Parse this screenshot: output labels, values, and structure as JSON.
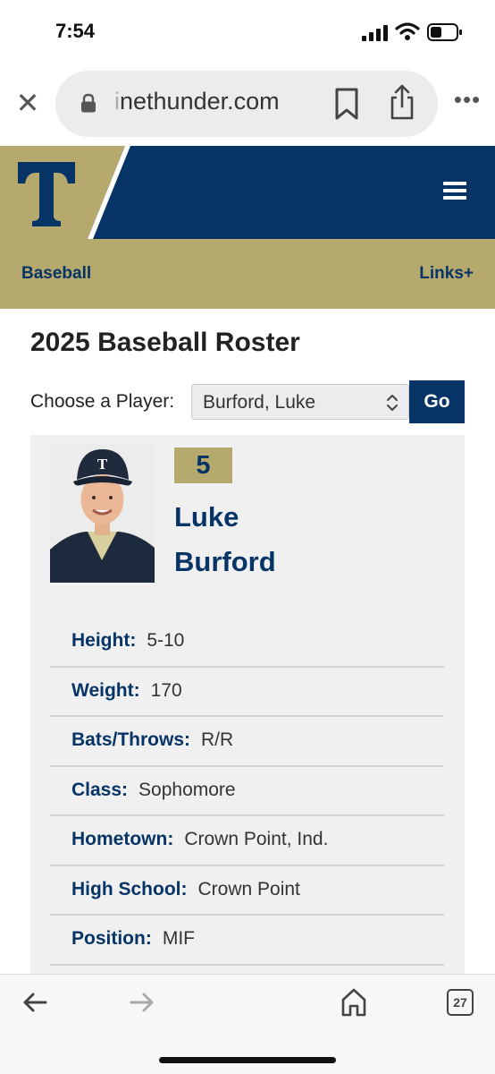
{
  "status_bar": {
    "time": "7:54"
  },
  "browser": {
    "url_faded": "i",
    "url_main": "nethunder.com",
    "tab_count": "27"
  },
  "site": {
    "logo_letter": "T",
    "nav_left": "Baseball",
    "nav_right": "Links+"
  },
  "roster": {
    "title": "2025 Baseball Roster",
    "choose_label": "Choose a Player:",
    "selected_player": "Burford, Luke",
    "go_label": "Go"
  },
  "player": {
    "number": "5",
    "first_name": "Luke",
    "last_name": "Burford",
    "photo_cap_letter": "T",
    "bio": [
      {
        "label": "Height:",
        "value": "5-10"
      },
      {
        "label": "Weight:",
        "value": "170"
      },
      {
        "label": "Bats/Throws:",
        "value": "R/R"
      },
      {
        "label": "Class:",
        "value": "Sophomore"
      },
      {
        "label": "Hometown:",
        "value": "Crown Point, Ind."
      },
      {
        "label": "High School:",
        "value": "Crown Point"
      },
      {
        "label": "Position:",
        "value": "MIF"
      }
    ]
  },
  "colors": {
    "navy": "#063466",
    "gold": "#b5a96e"
  }
}
